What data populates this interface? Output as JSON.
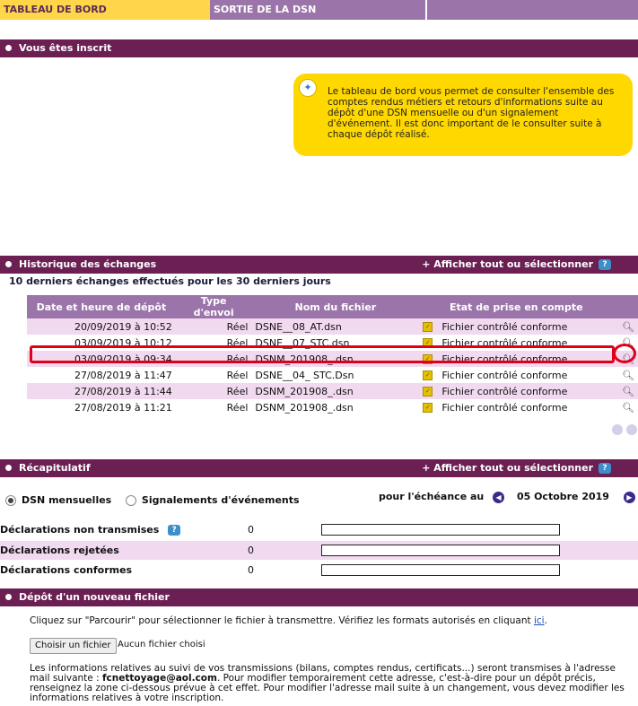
{
  "tabs": [
    "TABLEAU DE BORD",
    "SORTIE DE LA DSN",
    ""
  ],
  "section_inscrit": {
    "title": "Vous êtes inscrit"
  },
  "info_box": {
    "text": "Le tableau de bord vous permet de consulter l'ensemble des comptes rendus métiers et retours d'informations suite au dépôt d'une DSN mensuelle ou d'un signalement d'événement. Il est donc important de le consulter suite à chaque dépôt réalisé."
  },
  "history": {
    "title": "Historique des échanges",
    "action": "+ Afficher tout ou sélectionner",
    "help": "?",
    "subtitle": "10 derniers échanges effectués pour les 30 derniers jours",
    "columns": [
      "Date et heure de dépôt",
      "Type d'envoi",
      "Nom du fichier",
      "Etat de prise en compte"
    ],
    "rows": [
      {
        "date": "20/09/2019 à 10:52",
        "type": "Réel",
        "file": "DSNE__08_AT.dsn",
        "state": "Fichier contrôlé conforme",
        "highlighted": false
      },
      {
        "date": "03/09/2019 à 10:12",
        "type": "Réel",
        "file": "DSNE__07_STC.dsn",
        "state": "Fichier contrôlé conforme",
        "highlighted": false
      },
      {
        "date": "03/09/2019 à 09:34",
        "type": "Réel",
        "file": "DSNM_201908_.dsn",
        "state": "Fichier contrôlé conforme",
        "highlighted": true
      },
      {
        "date": "27/08/2019 à 11:47",
        "type": "Réel",
        "file": "DSNE__04_ STC.Dsn",
        "state": "Fichier contrôlé conforme",
        "highlighted": false
      },
      {
        "date": "27/08/2019 à 11:44",
        "type": "Réel",
        "file": "DSNM_201908_.dsn",
        "state": "Fichier contrôlé conforme",
        "highlighted": false
      },
      {
        "date": "27/08/2019 à 11:21",
        "type": "Réel",
        "file": "DSNM_201908_.dsn",
        "state": "Fichier contrôlé conforme",
        "highlighted": false
      }
    ]
  },
  "recap": {
    "title": "Récapitulatif",
    "action": "+ Afficher tout ou sélectionner",
    "help": "?",
    "radio_1": "DSN mensuelles",
    "radio_2": "Signalements d'événements",
    "echeance_label": "pour l'échéance au",
    "echeance_date": "05 Octobre 2019",
    "rows": [
      {
        "label": "Déclarations non transmises",
        "count": "0"
      },
      {
        "label": "Déclarations rejetées",
        "count": "0"
      },
      {
        "label": "Déclarations conformes",
        "count": "0"
      }
    ]
  },
  "depot": {
    "title": "Dépôt d'un nouveau fichier",
    "instruction": "Cliquez sur \"Parcourir\" pour sélectionner le fichier à transmettre. Vérifiez les formats autorisés en cliquant",
    "instruction_link": "ici",
    "file_button": "Choisir un fichier",
    "file_status": "Aucun fichier choisi",
    "notice_part1": "Les informations relatives au suivi de vos transmissions (bilans, comptes rendus, certificats...) seront transmises à l'adresse mail suivante : ",
    "notice_email": "fcnettoyage@aol.com",
    "notice_part2": ". Pour modifier temporairement cette adresse, c'est-à-dire pour un dépôt précis, renseignez la zone ci-dessous prévue à cet effet. Pour modifier l'adresse mail suite à un changement, vous devez modifier les informations relatives à votre inscription."
  },
  "colors": {
    "section_header": "#6b1f53",
    "tab_active": "#ffd54a",
    "table_header": "#9b74a9",
    "row_pink": "#f1d9ef",
    "info_box": "#ffd800",
    "highlight": "#e0001a"
  },
  "icons": {
    "bulb": "bulb-icon",
    "check": "check-icon",
    "magnifier": "magnifier-icon",
    "help": "help-icon"
  }
}
